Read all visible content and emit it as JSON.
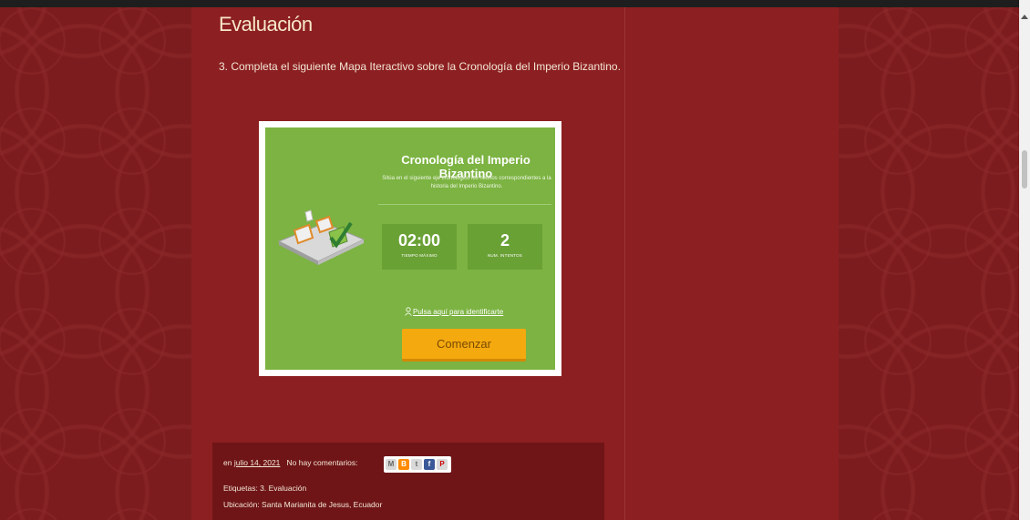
{
  "post": {
    "title": "Evaluación",
    "text": "3. Completa el siguiente Mapa Iteractivo sobre la Cronología del Imperio Bizantino."
  },
  "embed": {
    "title": "Cronología del Imperio Bizantino",
    "description": "Sitúa en el siguiente eje cronológico los hechos correspondientes a la historia del Imperio Bizantino.",
    "time_value": "02:00",
    "time_label": "TIEMPO MÁXIMO",
    "attempts_value": "2",
    "attempts_label": "NUM. INTENTOS",
    "login_link": "Pulsa aquí para identificarte",
    "start_button": "Comenzar",
    "accent_color": "#7cb342",
    "button_color": "#f4a90f"
  },
  "footer": {
    "prefix": "en",
    "date": "julio 14, 2021",
    "comments": "No hay comentarios:",
    "labels": "Etiquetas: 3. Evaluación",
    "location": "Ubicación: Santa Marianita de Jesus, Ecuador",
    "share_buttons": [
      "email-icon",
      "blog-icon",
      "twitter-icon",
      "facebook-icon",
      "pinterest-icon"
    ]
  }
}
